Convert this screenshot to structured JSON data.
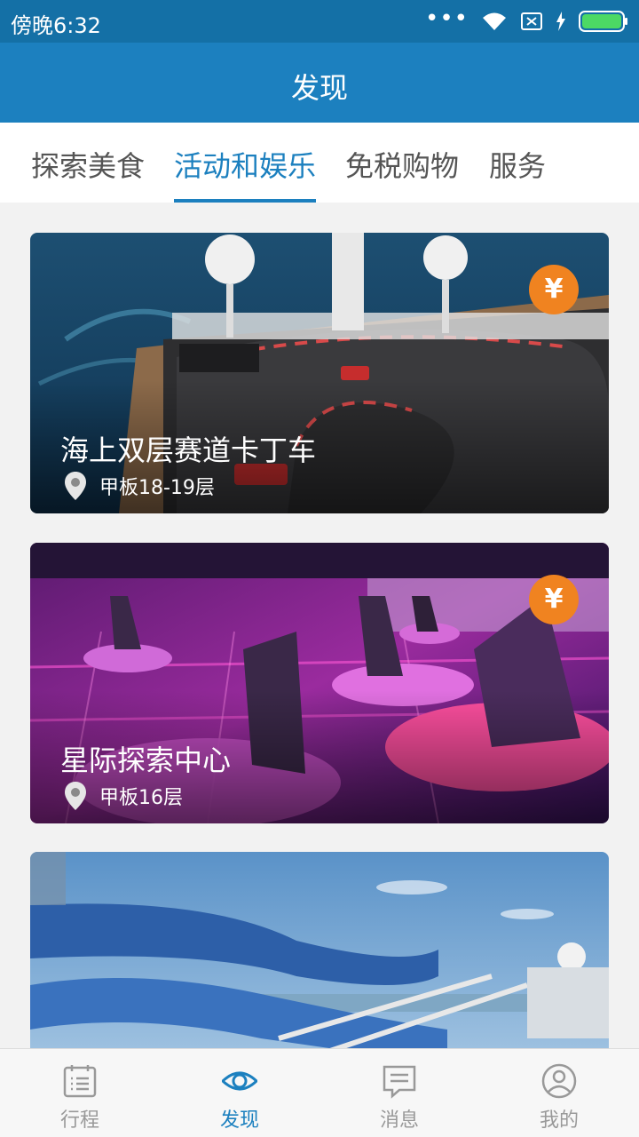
{
  "status_bar": {
    "time": "傍晚6:32",
    "icons": [
      "more-dots-icon",
      "wifi-icon",
      "no-sim-icon",
      "charging-icon",
      "battery-icon"
    ]
  },
  "header": {
    "title": "发现"
  },
  "tabs": [
    {
      "label": "探索美食",
      "active": false
    },
    {
      "label": "活动和娱乐",
      "active": true
    },
    {
      "label": "免税购物",
      "active": false
    },
    {
      "label": "服务",
      "active": false
    }
  ],
  "cards": [
    {
      "title": "海上双层赛道卡丁车",
      "location": "甲板18-19层",
      "badge": "¥",
      "image": "go-kart-track-photo"
    },
    {
      "title": "星际探索中心",
      "location": "甲板16层",
      "badge": "¥",
      "image": "bumper-car-neon-photo"
    },
    {
      "title": "",
      "location": "",
      "badge": "",
      "image": "water-slide-photo"
    }
  ],
  "bottom_nav": [
    {
      "label": "行程",
      "icon": "calendar-list-icon",
      "active": false
    },
    {
      "label": "发现",
      "icon": "eye-icon",
      "active": true
    },
    {
      "label": "消息",
      "icon": "message-icon",
      "active": false
    },
    {
      "label": "我的",
      "icon": "profile-icon",
      "active": false
    }
  ],
  "colors": {
    "primary": "#1c80bf",
    "status_bar": "#1470a6",
    "badge": "#f08320",
    "battery": "#4cd964"
  }
}
